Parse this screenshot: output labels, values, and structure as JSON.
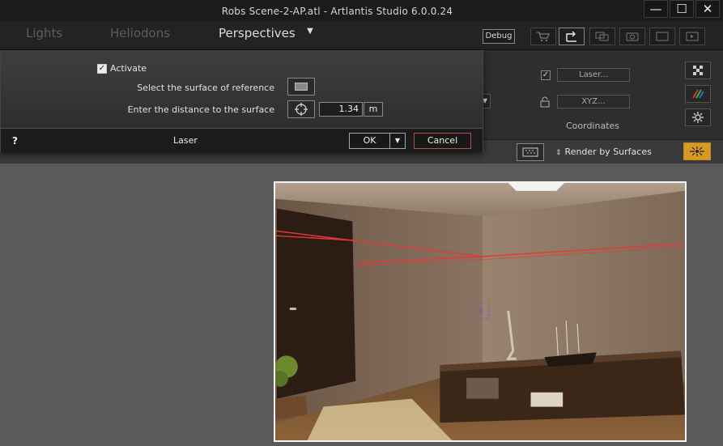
{
  "window": {
    "title": "Robs Scene-2-AP.atl - Artlantis Studio 6.0.0.24",
    "controls": {
      "minimize": "—",
      "maximize": "☐",
      "close": "✕"
    }
  },
  "tabs": {
    "items": [
      {
        "label": "Lights",
        "active": false
      },
      {
        "label": "Heliodons",
        "active": false
      },
      {
        "label": "Perspectives",
        "active": true
      }
    ],
    "dropdown_glyph": "▼"
  },
  "toolbar": {
    "debug_label": "Debug",
    "icons": [
      "cart-icon",
      "export-icon",
      "windows-icon",
      "camera-icon",
      "screen-icon",
      "media-icon"
    ]
  },
  "coordinates": {
    "label": "Coordinates",
    "laser_value": "Laser...",
    "xyz_value": "XYZ...",
    "checked_glyph": "✓"
  },
  "render": {
    "mode_label": "Render by Surfaces",
    "mode_glyph": "⇕",
    "laser_active_color": "#d79a22"
  },
  "dialog": {
    "title": "Laser",
    "help_label": "?",
    "activate_label": "Activate",
    "activate_checked": true,
    "activate_glyph": "✓",
    "surface_label": "Select the surface of reference",
    "distance_label": "Enter the distance to the surface",
    "distance_value": "1.34",
    "unit": "m",
    "ok_label": "OK",
    "ok_arrow_glyph": "▼",
    "cancel_label": "Cancel",
    "cancel_border_color": "#c04a4a"
  }
}
